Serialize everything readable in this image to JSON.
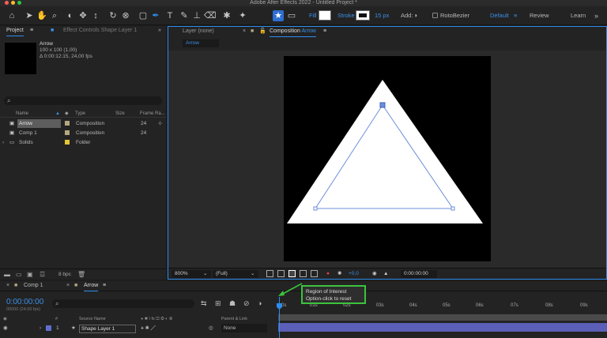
{
  "window": {
    "title": "Adobe After Effects 2022 - Untitled Project *"
  },
  "toolbar": {
    "fill_label": "Fill",
    "stroke_label": "Stroke",
    "stroke_width": "15 px",
    "add_label": "Add:",
    "rotobezier_label": "RotoBezier",
    "workspace_default": "Default",
    "workspace_review": "Review",
    "workspace_learn": "Learn",
    "colors": {
      "fill": "#ffffff",
      "stroke": "#ffffff",
      "accent": "#2d8ceb"
    }
  },
  "project": {
    "tab_project": "Project",
    "tab_effects": "Effect Controls Shape Layer 1",
    "selected_name": "Arrow",
    "selected_size": "100 x 100 (1,00)",
    "selected_duration": "Δ 0:00:12:15, 24,00 fps",
    "columns": {
      "name": "Name",
      "type": "Type",
      "size": "Size",
      "frame_rate": "Frame Ra..."
    },
    "items": [
      {
        "name": "Arrow",
        "type": "Composition",
        "frame_rate": "24",
        "label_color": "#b5a77e",
        "icon": "composition-icon"
      },
      {
        "name": "Comp 1",
        "type": "Composition",
        "frame_rate": "24",
        "label_color": "#b5a77e",
        "icon": "composition-icon"
      },
      {
        "name": "Solids",
        "type": "Folder",
        "frame_rate": "",
        "label_color": "#e2c636",
        "icon": "folder-icon"
      }
    ],
    "bpc": "8 bpc"
  },
  "composition": {
    "tab_layer": "Layer (none)",
    "tab_comp_prefix": "Composition",
    "tab_comp_name": "Arrow",
    "sub_tab": "Arrow",
    "zoom": "800%",
    "resolution": "(Full)",
    "exposure": "+0,0",
    "timecode": "0:00:00:00"
  },
  "timeline": {
    "tab_comp1": "Comp 1",
    "tab_arrow": "Arrow",
    "timecode": "0:00:00:00",
    "fps": "00000 (24.00 fps)",
    "col_source": "Source Name",
    "col_parent": "Parent & Link",
    "layer_index": "1",
    "layer_name": "Shape Layer 1",
    "layer_parent": "None",
    "ruler": [
      "0s",
      "01s",
      "02s",
      "03s",
      "04s",
      "05s",
      "06s",
      "07s",
      "08s",
      "09s"
    ]
  },
  "tooltip": {
    "line1": "Region of Interest",
    "line2": "Option-click to reset"
  }
}
